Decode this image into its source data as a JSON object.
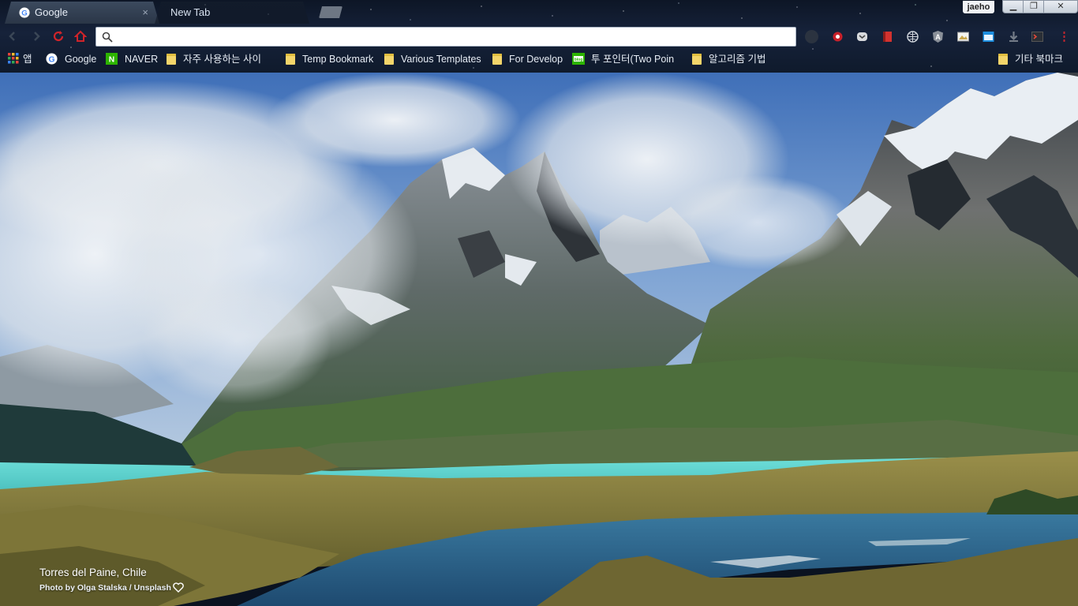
{
  "window": {
    "profile_name": "jaeho",
    "controls": {
      "minimize": "▁",
      "restore": "❐",
      "close": "✕"
    }
  },
  "tabs": [
    {
      "title": "Google",
      "active": true,
      "close": "×",
      "icon": "google-favicon"
    },
    {
      "title": "New Tab",
      "active": false
    }
  ],
  "toolbar": {
    "omnibox_value": "",
    "omnibox_placeholder": "",
    "nav_icons": [
      "back-icon",
      "forward-icon",
      "reload-icon",
      "home-icon"
    ],
    "extensions": [
      "ext-circle-icon",
      "ext-bug-icon",
      "ext-pocket-icon",
      "ext-book-icon",
      "ext-globe-icon",
      "ext-angular-icon",
      "ext-image-icon",
      "ext-window-icon",
      "ext-download-icon",
      "ext-terminal-icon",
      "menu-icon"
    ]
  },
  "bookmarks": [
    {
      "label": "앱",
      "icon": "apps-grid-icon"
    },
    {
      "label": "Google",
      "icon": "google-favicon"
    },
    {
      "label": "NAVER",
      "icon": "naver-icon"
    },
    {
      "label": "자주 사용하는 사이",
      "icon": "folder-icon"
    },
    {
      "label": "Temp Bookmark",
      "icon": "folder-icon"
    },
    {
      "label": "Various Templates",
      "icon": "folder-icon"
    },
    {
      "label": "For Develop",
      "icon": "folder-icon"
    },
    {
      "label": "투 포인터(Two Poin",
      "icon": "blog-icon"
    },
    {
      "label": "알고리즘 기법",
      "icon": "folder-icon"
    }
  ],
  "other_bookmarks": {
    "label": "기타 북마크",
    "icon": "folder-icon"
  },
  "background": {
    "location": "Torres del Paine, Chile",
    "credit": "Photo by Olga Stalska / Unsplash",
    "colors": {
      "sky": "#4a78b8",
      "lake": "#5fd3cf",
      "lake_lower": "#2a5a82",
      "grass": "#7d7a3a",
      "rock": "#5a6066",
      "snow": "#e8edf2"
    }
  }
}
